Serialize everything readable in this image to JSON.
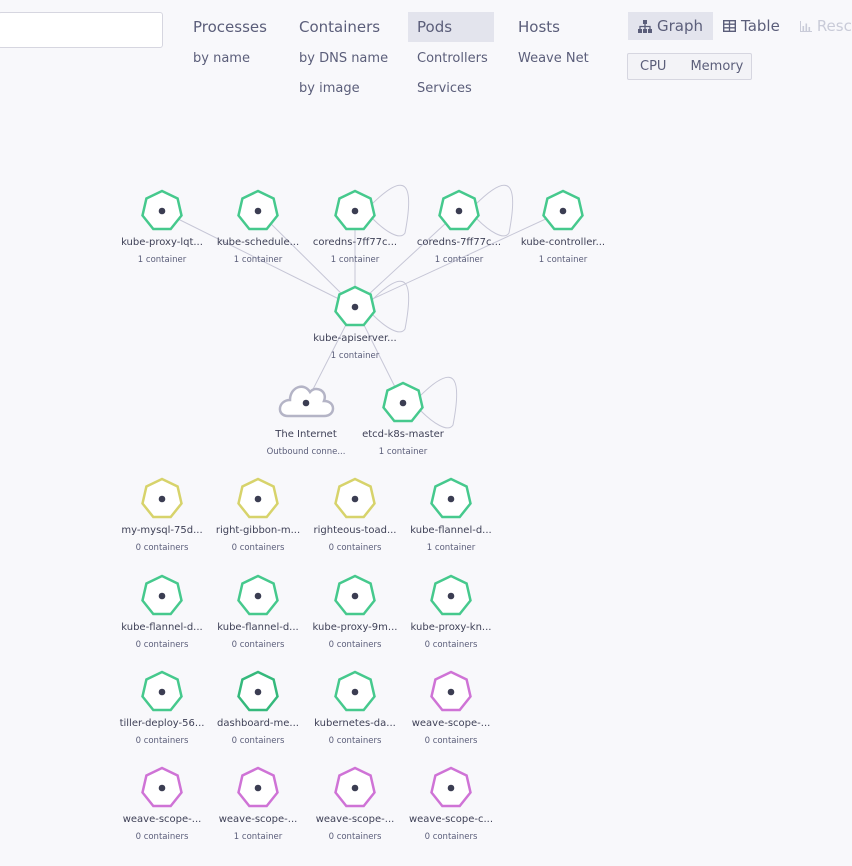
{
  "search": {
    "placeholder": ""
  },
  "topologies": [
    {
      "label": "Processes",
      "subs": [
        "by name"
      ]
    },
    {
      "label": "Containers",
      "subs": [
        "by DNS name",
        "by image"
      ]
    },
    {
      "label": "Pods",
      "subs": [
        "Controllers",
        "Services"
      ],
      "active": true
    },
    {
      "label": "Hosts",
      "subs": [
        "Weave Net"
      ]
    }
  ],
  "view_modes": [
    {
      "label": "Graph",
      "icon": "graph-icon",
      "active": true
    },
    {
      "label": "Table",
      "icon": "table-icon"
    },
    {
      "label": "Resc",
      "icon": "chart-icon",
      "disabled": true
    }
  ],
  "metrics": [
    "CPU",
    "Memory"
  ],
  "colors": {
    "green": "#46c98d",
    "dark_green": "#35b97c",
    "yellow": "#d7d36b",
    "violet": "#cf73d6",
    "cloud": "#b4b4c6",
    "edge": "#c6c6d6",
    "node_dot": "#3b3d52"
  },
  "nodes": [
    {
      "label": "kube-proxy-lqt...",
      "sub": "1 container",
      "shape": "heptagon",
      "color": "green"
    },
    {
      "label": "kube-schedule...",
      "sub": "1 container",
      "shape": "heptagon",
      "color": "green"
    },
    {
      "label": "coredns-7ff77c...",
      "sub": "1 container",
      "shape": "heptagon",
      "color": "green"
    },
    {
      "label": "coredns-7ff77c...",
      "sub": "1 container",
      "shape": "heptagon",
      "color": "green"
    },
    {
      "label": "kube-controller...",
      "sub": "1 container",
      "shape": "heptagon",
      "color": "green"
    },
    {
      "label": "kube-apiserver...",
      "sub": "1 container",
      "shape": "heptagon",
      "color": "green"
    },
    {
      "label": "The Internet",
      "sub": "Outbound conne...",
      "shape": "cloud",
      "color": "cloud"
    },
    {
      "label": "etcd-k8s-master",
      "sub": "1 container",
      "shape": "heptagon",
      "color": "green"
    },
    {
      "label": "my-mysql-75d...",
      "sub": "0 containers",
      "shape": "heptagon",
      "color": "yellow"
    },
    {
      "label": "right-gibbon-m...",
      "sub": "0 containers",
      "shape": "heptagon",
      "color": "yellow"
    },
    {
      "label": "righteous-toad...",
      "sub": "0 containers",
      "shape": "heptagon",
      "color": "yellow"
    },
    {
      "label": "kube-flannel-d...",
      "sub": "1 container",
      "shape": "heptagon",
      "color": "green"
    },
    {
      "label": "kube-flannel-d...",
      "sub": "0 containers",
      "shape": "heptagon",
      "color": "green"
    },
    {
      "label": "kube-flannel-d...",
      "sub": "0 containers",
      "shape": "heptagon",
      "color": "green"
    },
    {
      "label": "kube-proxy-9m...",
      "sub": "0 containers",
      "shape": "heptagon",
      "color": "green"
    },
    {
      "label": "kube-proxy-kn...",
      "sub": "0 containers",
      "shape": "heptagon",
      "color": "green"
    },
    {
      "label": "tiller-deploy-56...",
      "sub": "0 containers",
      "shape": "heptagon",
      "color": "green"
    },
    {
      "label": "dashboard-me...",
      "sub": "0 containers",
      "shape": "heptagon",
      "color": "dark_green"
    },
    {
      "label": "kubernetes-da...",
      "sub": "0 containers",
      "shape": "heptagon",
      "color": "green"
    },
    {
      "label": "weave-scope-...",
      "sub": "0 containers",
      "shape": "heptagon",
      "color": "violet"
    },
    {
      "label": "weave-scope-...",
      "sub": "0 containers",
      "shape": "heptagon",
      "color": "violet"
    },
    {
      "label": "weave-scope-...",
      "sub": "1 container",
      "shape": "heptagon",
      "color": "violet"
    },
    {
      "label": "weave-scope-...",
      "sub": "0 containers",
      "shape": "heptagon",
      "color": "violet"
    },
    {
      "label": "weave-scope-c...",
      "sub": "0 containers",
      "shape": "heptagon",
      "color": "violet"
    }
  ],
  "edges": [
    [
      0,
      5
    ],
    [
      1,
      5
    ],
    [
      2,
      5
    ],
    [
      3,
      5
    ],
    [
      4,
      5
    ],
    [
      5,
      6
    ],
    [
      5,
      7
    ]
  ],
  "self_loops": [
    2,
    3,
    5,
    7
  ]
}
